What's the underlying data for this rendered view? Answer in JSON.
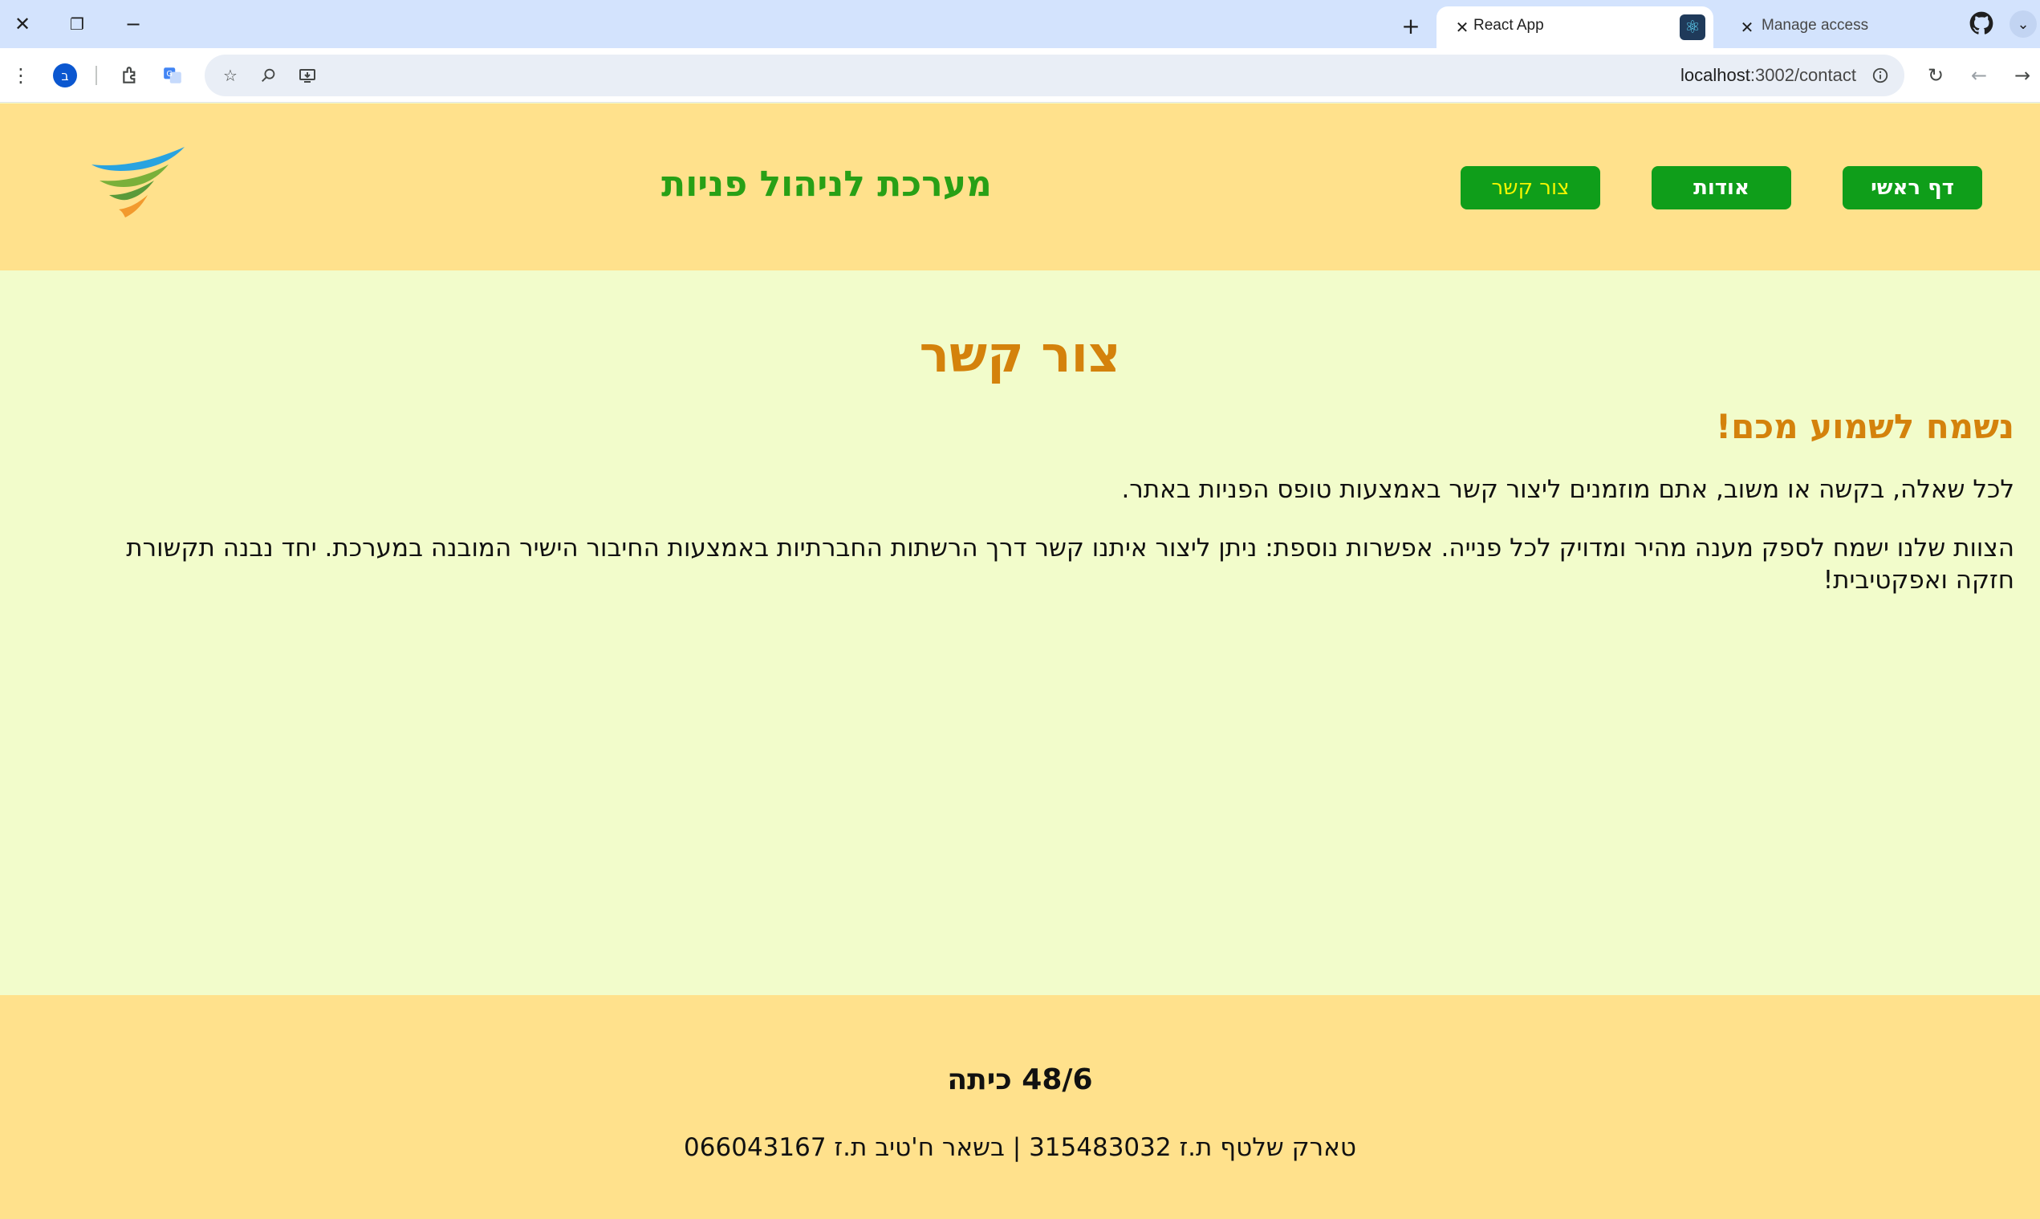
{
  "browser": {
    "tabs": [
      {
        "title": "React App",
        "active": true,
        "favicon": "react-icon"
      },
      {
        "title": "Manage access",
        "active": false,
        "favicon": "github-icon"
      }
    ],
    "address": {
      "host": "localhost",
      "path": ":3002/contact"
    },
    "profile_initial": "ב"
  },
  "header": {
    "nav": {
      "home": "דף ראשי",
      "about": "אודות",
      "contact": "צור קשר"
    },
    "site_title": "מערכת לניהול פניות"
  },
  "main": {
    "title": "צור קשר",
    "subtitle": "נשמח לשמוע מכם!",
    "paragraph1": "לכל שאלה, בקשה או משוב, אתם מוזמנים ליצור קשר באמצעות טופס הפניות באתר.",
    "paragraph2": "הצוות שלנו ישמח לספק מענה מהיר ומדויק לכל פנייה. אפשרות נוספת: ניתן ליצור איתנו קשר דרך הרשתות החברתיות באמצעות החיבור הישיר המובנה במערכת. יחד נבנה תקשורת חזקה ואפקטיבית!"
  },
  "footer": {
    "class": "48/6 כיתה",
    "names": "טארק שלטף ת.ז 315483032 | בשאר ח'טיב ת.ז 066043167"
  },
  "colors": {
    "header_bg": "#ffe18c",
    "main_bg": "#f2fccb",
    "nav_green": "#0f9e1a",
    "title_orange": "#d4820c",
    "site_title_green": "#28a016"
  }
}
